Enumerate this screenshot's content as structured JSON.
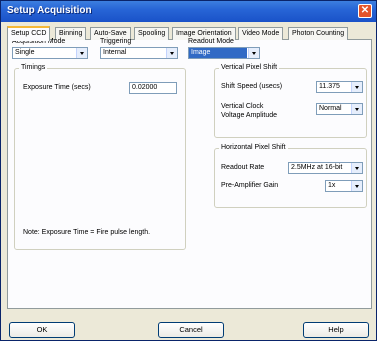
{
  "window": {
    "title": "Setup Acquisition",
    "close_glyph": "✕"
  },
  "tabs": [
    {
      "label": "Setup CCD"
    },
    {
      "label": "Binning"
    },
    {
      "label": "Auto-Save"
    },
    {
      "label": "Spooling"
    },
    {
      "label": "Image Orientation"
    },
    {
      "label": "Video Mode"
    },
    {
      "label": "Photon Counting"
    }
  ],
  "top": {
    "acquisition_mode": {
      "label": "Acquisition Mode",
      "value": "Single"
    },
    "triggering": {
      "label": "Triggering",
      "value": "Internal"
    },
    "readout_mode": {
      "label": "Readout Mode",
      "value": "Image"
    }
  },
  "timings": {
    "title": "Timings",
    "exposure_label": "Exposure Time (secs)",
    "exposure_value": "0.02000",
    "note": "Note: Exposure Time = Fire pulse length."
  },
  "vertical_shift": {
    "title": "Vertical Pixel Shift",
    "shift_speed_label": "Shift Speed (usecs)",
    "shift_speed_value": "11.375",
    "clock_label_1": "Vertical Clock",
    "clock_label_2": "Voltage Amplitude",
    "clock_value": "Normal"
  },
  "horizontal_shift": {
    "title": "Horizontal Pixel Shift",
    "readout_rate_label": "Readout Rate",
    "readout_rate_value": "2.5MHz at 16-bit",
    "preamp_label": "Pre-Amplifier Gain",
    "preamp_value": "1x"
  },
  "buttons": {
    "ok": "OK",
    "cancel": "Cancel",
    "help": "Help"
  }
}
